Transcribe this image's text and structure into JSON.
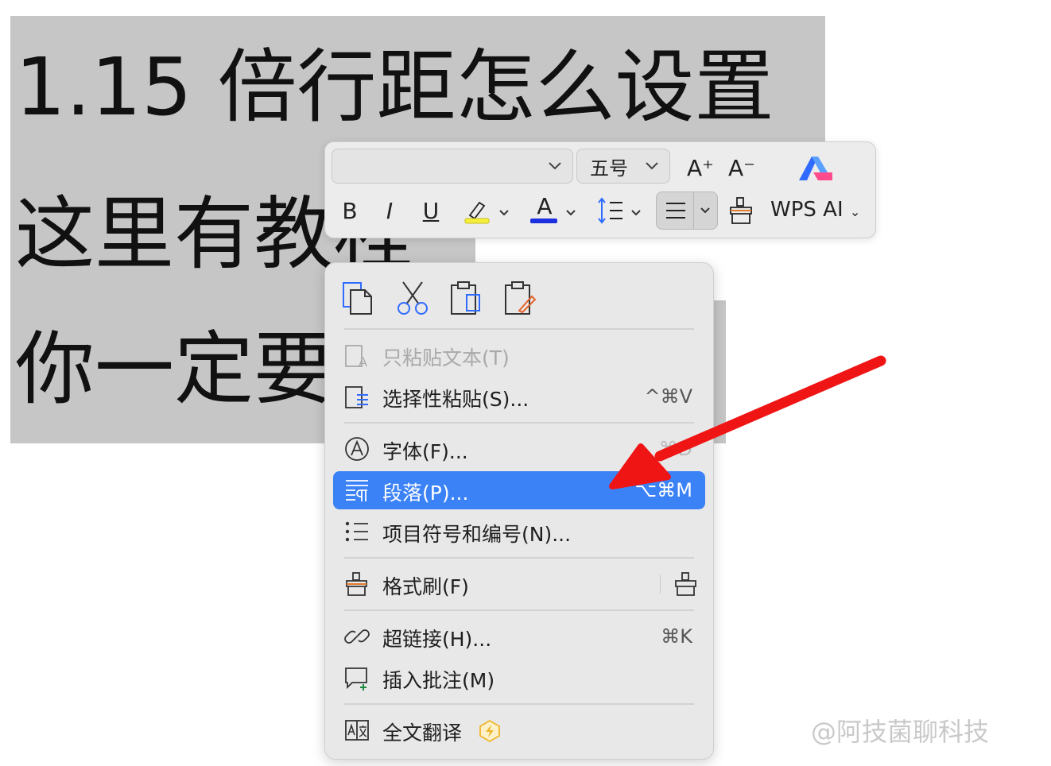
{
  "document": {
    "line1": "1.15 倍行距怎么设置",
    "line2": "这里有教程",
    "line3": "你一定要"
  },
  "toolbar": {
    "font_name": "",
    "font_size": "五号",
    "grow_font": "A⁺",
    "shrink_font": "A⁻",
    "bold": "B",
    "italic": "I",
    "underline": "U",
    "font_color_glyph": "A",
    "wps_ai_label": "WPS AI",
    "highlight_color": "#f5ee3a",
    "font_color": "#1c2fe0"
  },
  "menu": {
    "paste_text_only": "只粘贴文本(T)",
    "paste_special": "选择性粘贴(S)...",
    "paste_special_shortcut": "^⌘V",
    "font": "字体(F)...",
    "font_shortcut": "⌘D",
    "paragraph": "段落(P)...",
    "paragraph_shortcut": "⌥⌘M",
    "bullets": "项目符号和编号(N)...",
    "format_painter": "格式刷(F)",
    "hyperlink": "超链接(H)...",
    "hyperlink_shortcut": "⌘K",
    "insert_comment": "插入批注(M)",
    "translate": "全文翻译",
    "highlight_color": "#3b82f6"
  },
  "watermark": "@阿技菌聊科技"
}
